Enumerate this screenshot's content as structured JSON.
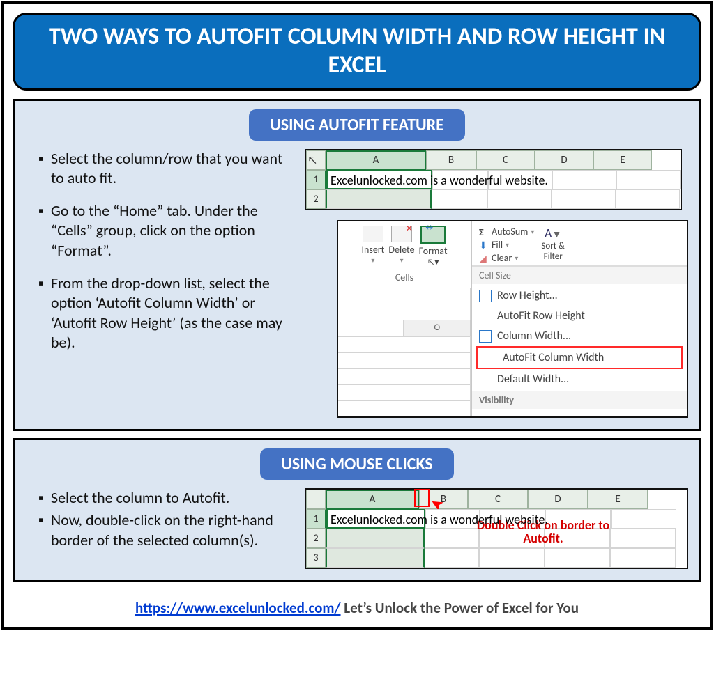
{
  "header": {
    "title": "TWO WAYS TO AUTOFIT COLUMN WIDTH AND ROW HEIGHT IN EXCEL"
  },
  "section1": {
    "title": "USING AUTOFIT FEATURE",
    "bullets": [
      "Select the column/row that you want to auto fit.",
      "Go to the “Home” tab. Under the “Cells” group, click on the option “Format”.",
      "From the drop-down list, select the option ‘Autofit Column Width’ or ‘Autofit Row Height’ (as the case may be)."
    ],
    "sheet": {
      "columns": [
        "A",
        "B",
        "C",
        "D",
        "E"
      ],
      "rows": [
        "1",
        "2"
      ],
      "cell_text": "Excelunlocked.com is a wonderful website."
    },
    "ribbon": {
      "buttons": {
        "insert": "Insert",
        "delete": "Delete",
        "format": "Format"
      },
      "group": "Cells",
      "editing": {
        "autosum": "AutoSum",
        "fill": "Fill",
        "clear": "Clear"
      },
      "sort": {
        "label1": "Sort &",
        "label2": "Filter"
      },
      "col_o": "O",
      "menu_header": "Cell Size",
      "menu_items": {
        "row_height": "Row Height...",
        "autofit_row": "AutoFit Row Height",
        "col_width": "Column Width...",
        "autofit_col": "AutoFit Column Width",
        "default_width": "Default Width..."
      },
      "visibility": "Visibility"
    }
  },
  "section2": {
    "title": "USING MOUSE CLICKS",
    "bullets": [
      "Select the column to Autofit.",
      "Now, double-click on the right-hand border of the selected column(s)."
    ],
    "sheet": {
      "columns": [
        "A",
        "B",
        "C",
        "D",
        "E"
      ],
      "rows": [
        "1",
        "2",
        "3"
      ],
      "cell_text": "Excelunlocked.com is a wonderful website.",
      "annotation": "Double Click on border to Autofit."
    }
  },
  "footer": {
    "url_text": "https://www.excelunlocked.com/",
    "tagline": " Let’s Unlock the Power of Excel for You"
  }
}
